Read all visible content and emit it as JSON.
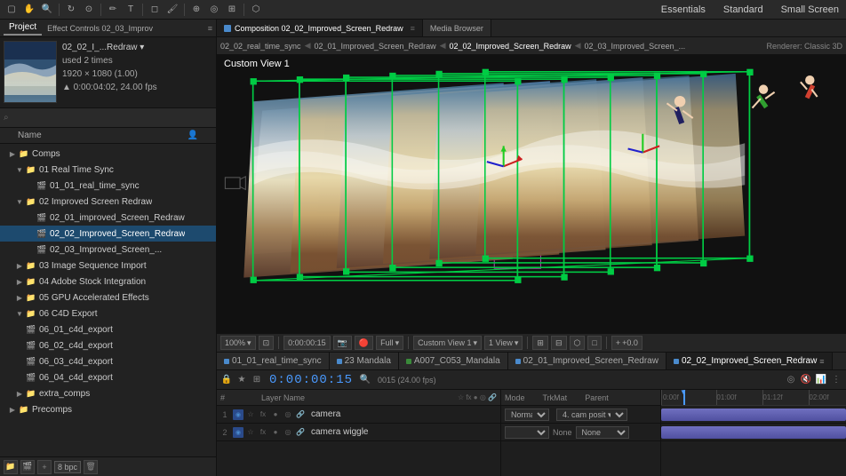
{
  "toolbar": {
    "workspace": {
      "essentials": "Essentials",
      "standard": "Standard",
      "small_screen": "Small Screen"
    }
  },
  "left_panel": {
    "tabs": [
      "Project",
      "Effect Controls 02_03_Improv"
    ],
    "project_name": "02_02_I_...Redraw ▾",
    "project_used": "used 2 times",
    "project_size": "1920 × 1080 (1.00)",
    "project_duration": "▲ 0:00:04:02, 24.00 fps",
    "search_placeholder": "",
    "tree": {
      "header": "Name",
      "items": [
        {
          "id": "comps",
          "label": "Comps",
          "type": "folder",
          "depth": 0,
          "expanded": true
        },
        {
          "id": "01_real_time_sync",
          "label": "01 Real Time Sync",
          "type": "folder",
          "depth": 1,
          "expanded": true
        },
        {
          "id": "01_01_real_time_sync",
          "label": "01_01_real_time_sync",
          "type": "file",
          "depth": 2
        },
        {
          "id": "02_improved_screen_redraw",
          "label": "02 Improved Screen Redraw",
          "type": "folder",
          "depth": 1,
          "expanded": true
        },
        {
          "id": "02_01_improved",
          "label": "02_01_improved_Screen_Redraw",
          "type": "file",
          "depth": 2
        },
        {
          "id": "02_02_improved",
          "label": "02_02_Improved_Screen_Redraw",
          "type": "file",
          "depth": 2,
          "selected": true
        },
        {
          "id": "02_03_improved",
          "label": "02_03_Improved_Screen_...",
          "type": "file",
          "depth": 2
        },
        {
          "id": "03_image_sequence",
          "label": "03 Image Sequence Import",
          "type": "folder",
          "depth": 1
        },
        {
          "id": "04_adobe_stock",
          "label": "04 Adobe Stock Integration",
          "type": "folder",
          "depth": 1
        },
        {
          "id": "05_gpu",
          "label": "05 GPU Accelerated Effects",
          "type": "folder",
          "depth": 1
        },
        {
          "id": "06_c4d_export",
          "label": "06 C4D Export",
          "type": "folder",
          "depth": 1,
          "expanded": true
        },
        {
          "id": "06_01_c4d",
          "label": "06_01_c4d_export",
          "type": "file",
          "depth": 2
        },
        {
          "id": "06_02_c4d",
          "label": "06_02_c4d_export",
          "type": "file",
          "depth": 2
        },
        {
          "id": "06_03_c4d",
          "label": "06_03_c4d_export",
          "type": "file",
          "depth": 2
        },
        {
          "id": "06_04_c4d",
          "label": "06_04_c4d_export",
          "type": "file",
          "depth": 2
        },
        {
          "id": "extra_comps",
          "label": "extra_comps",
          "type": "folder",
          "depth": 1
        },
        {
          "id": "precomps",
          "label": "Precomps",
          "type": "folder",
          "depth": 0
        }
      ]
    },
    "bpc": "8 bpc"
  },
  "comp_tabs": [
    {
      "id": "02_02",
      "label": "Composition 02_02_Improved_Screen_Redraw",
      "active": true
    },
    {
      "id": "media_browser",
      "label": "Media Browser",
      "active": false
    }
  ],
  "breadcrumb": {
    "items": [
      "02_02_real_time_sync",
      "02_01_Improved_Screen_Redraw",
      "02_02_Improved_Screen_Redraw",
      "02_03_Improved_Screen_..."
    ],
    "renderer": "Renderer: Classic 3D"
  },
  "viewport": {
    "label": "Custom View 1"
  },
  "viewer_toolbar": {
    "zoom": "100%",
    "time": "0:00:00:15",
    "quality": "Full",
    "view": "Custom View 1",
    "views": "1 View",
    "value": "+0.0"
  },
  "timeline": {
    "tabs": [
      {
        "id": "01_01",
        "label": "01_01_real_time_sync"
      },
      {
        "id": "23_mandala",
        "label": "23 Mandala"
      },
      {
        "id": "a007",
        "label": "A007_C053_Mandala"
      },
      {
        "id": "02_01",
        "label": "02_01_Improved_Screen_Redraw"
      },
      {
        "id": "02_02",
        "label": "02_02_Improved_Screen_Redraw",
        "active": true
      }
    ],
    "time_display": "0:00:00:15",
    "frame_info": "0015 (24.00 fps)",
    "ruler": {
      "markers": [
        "0:00f",
        "01:00f",
        "01:12f",
        "02:00f"
      ]
    },
    "layers": [
      {
        "num": "1",
        "name": "camera",
        "mode": "Norma",
        "trkmat": "",
        "parent": "4. cam posit ▾"
      },
      {
        "num": "2",
        "name": "camera wiggle",
        "mode": "",
        "trkmat": "None",
        "parent": ""
      }
    ],
    "layer_header": {
      "num": "#",
      "name": "Layer Name",
      "mode": "Mode",
      "trkmat": "TrkMat",
      "parent": "Parent"
    }
  }
}
